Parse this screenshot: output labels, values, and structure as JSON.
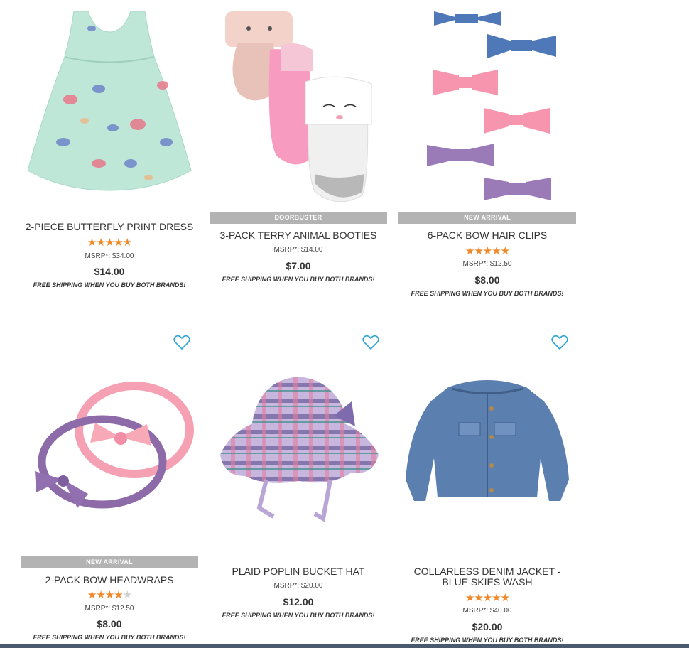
{
  "products": [
    {
      "name": "2-PIECE BUTTERFLY PRINT DRESS",
      "badge": "",
      "rating": 5,
      "msrp": "MSRP*: $34.00",
      "price": "$14.00",
      "shipping": "FREE SHIPPING WHEN YOU BUY BOTH BRANDS!",
      "image_icon": "butterfly-dress-image"
    },
    {
      "name": "3-PACK TERRY ANIMAL BOOTIES",
      "badge": "DOORBUSTER",
      "rating": null,
      "msrp": "MSRP*: $14.00",
      "price": "$7.00",
      "shipping": "FREE SHIPPING WHEN YOU BUY BOTH BRANDS!",
      "image_icon": "booties-image"
    },
    {
      "name": "6-PACK BOW HAIR CLIPS",
      "badge": "NEW ARRIVAL",
      "rating": 5,
      "msrp": "MSRP*: $12.50",
      "price": "$8.00",
      "shipping": "FREE SHIPPING WHEN YOU BUY BOTH BRANDS!",
      "image_icon": "bow-clips-image"
    },
    {
      "name": "2-PACK BOW HEADWRAPS",
      "badge": "NEW ARRIVAL",
      "rating": 3.5,
      "msrp": "MSRP*: $12.50",
      "price": "$8.00",
      "shipping": "FREE SHIPPING WHEN YOU BUY BOTH BRANDS!",
      "image_icon": "headwraps-image"
    },
    {
      "name": "PLAID POPLIN BUCKET HAT",
      "badge": "",
      "rating": null,
      "msrp": "MSRP*: $20.00",
      "price": "$12.00",
      "shipping": "FREE SHIPPING WHEN YOU BUY BOTH BRANDS!",
      "image_icon": "bucket-hat-image"
    },
    {
      "name": "COLLARLESS DENIM JACKET - BLUE SKIES WASH",
      "badge": "",
      "rating": 5,
      "msrp": "MSRP*: $40.00",
      "price": "$20.00",
      "shipping": "FREE SHIPPING WHEN YOU BUY BOTH BRANDS!",
      "image_icon": "denim-jacket-image"
    }
  ],
  "colors": {
    "star": "#f0892a",
    "star_empty": "#cfcfcf",
    "badge_bg": "#b3b3b3",
    "heart": "#29a3d6"
  }
}
